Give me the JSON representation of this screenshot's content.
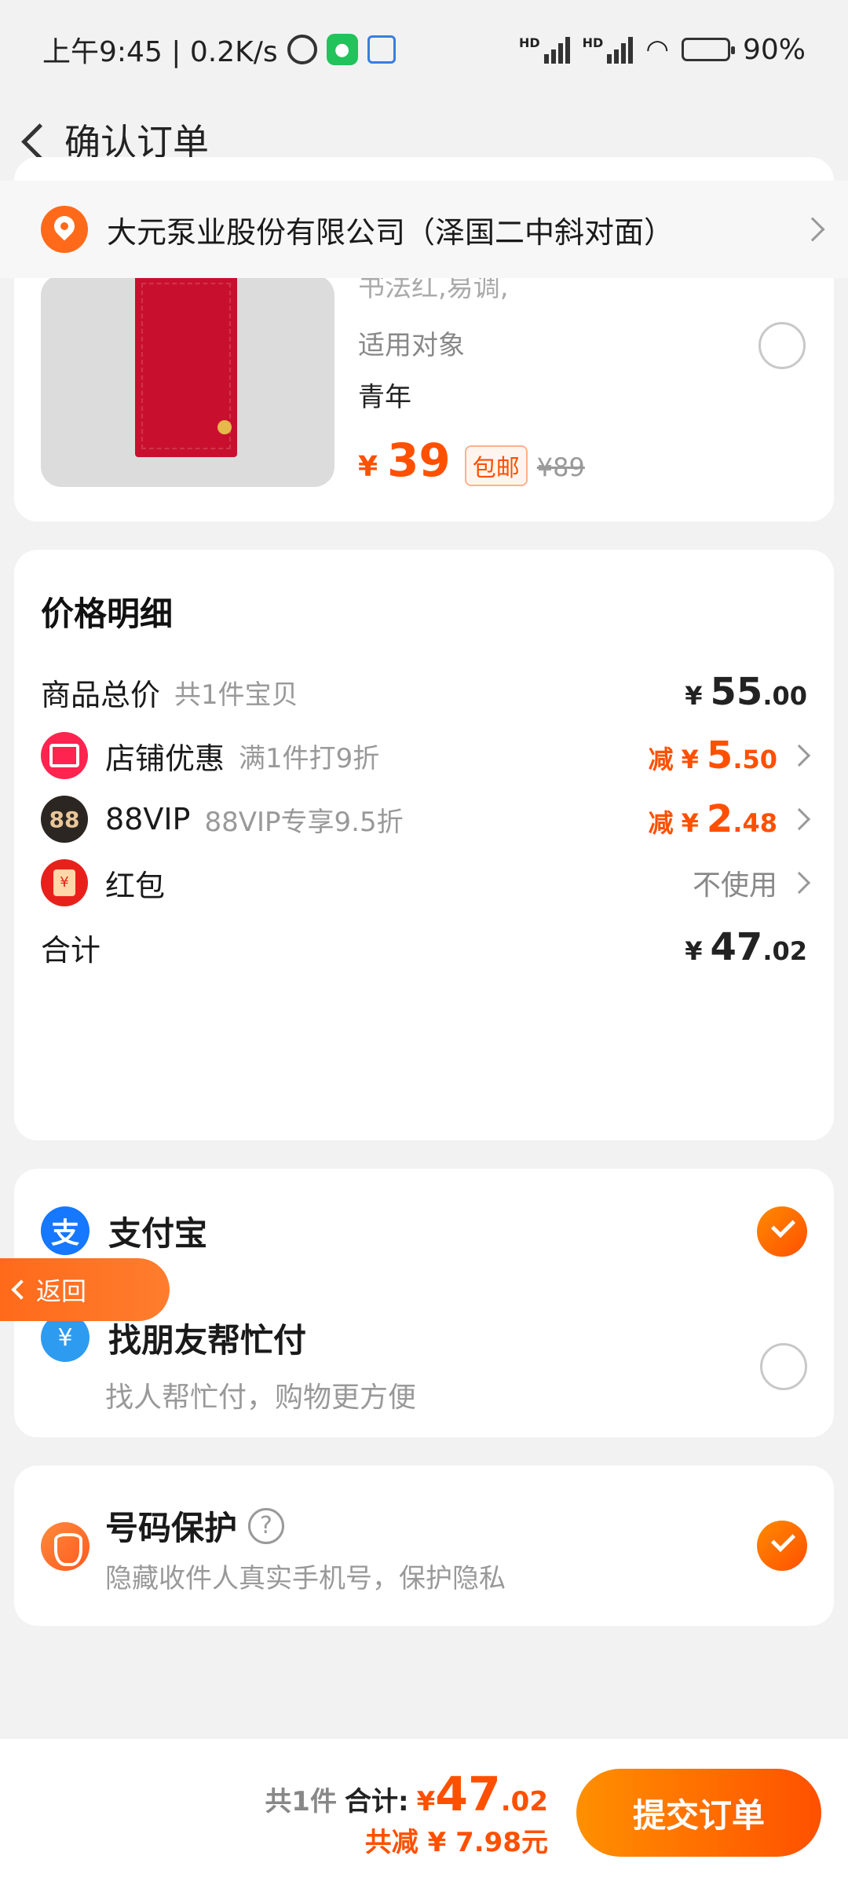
{
  "status": {
    "time_speed": "上午9:45 | 0.2K/s",
    "battery": "90%"
  },
  "header": {
    "title": "确认订单"
  },
  "address": {
    "text": "大元泵业股份有限公司（泽国二中斜对面）"
  },
  "product": {
    "faded_text": "书法红,易调,",
    "target_label": "适用对象",
    "target_value": "青年",
    "currency": "¥",
    "price": "39",
    "shipping_badge": "包邮",
    "original_price": "¥89"
  },
  "breakdown": {
    "title": "价格明细",
    "goods_total": {
      "label": "商品总价",
      "sub": "共1件宝贝",
      "symbol": "¥",
      "int": "55",
      "dec": ".00"
    },
    "shop_discount": {
      "label": "店铺优惠",
      "sub": "满1件打9折",
      "minus": "减",
      "symbol": "¥",
      "int": "5",
      "dec": ".50"
    },
    "vip": {
      "icon_text": "88",
      "label": "88VIP",
      "sub": "88VIP专享9.5折",
      "minus": "减",
      "symbol": "¥",
      "int": "2",
      "dec": ".48"
    },
    "hongbao": {
      "label": "红包",
      "value": "不使用",
      "icon_text": "¥"
    },
    "total": {
      "label": "合计",
      "symbol": "¥",
      "int": "47",
      "dec": ".02"
    }
  },
  "payment": {
    "alipay": {
      "icon_text": "支",
      "label": "支付宝",
      "selected": true
    },
    "friend": {
      "icon_text": "¥",
      "label": "找朋友帮忙付",
      "sub": "找人帮忙付，购物更方便",
      "selected": false
    }
  },
  "floating_back": {
    "label": "返回"
  },
  "protect": {
    "title": "号码保护",
    "help": "?",
    "sub": "隐藏收件人真实手机号，保护隐私",
    "selected": true
  },
  "bottom": {
    "count": "共1件",
    "total_label": "合计:",
    "total_symbol": "¥",
    "total_int": "47",
    "total_dec": ".02",
    "saved": "共减 ¥ 7.98元",
    "submit": "提交订单"
  },
  "colors": {
    "accent": "#ff5000",
    "background": "#f2f2f2"
  }
}
